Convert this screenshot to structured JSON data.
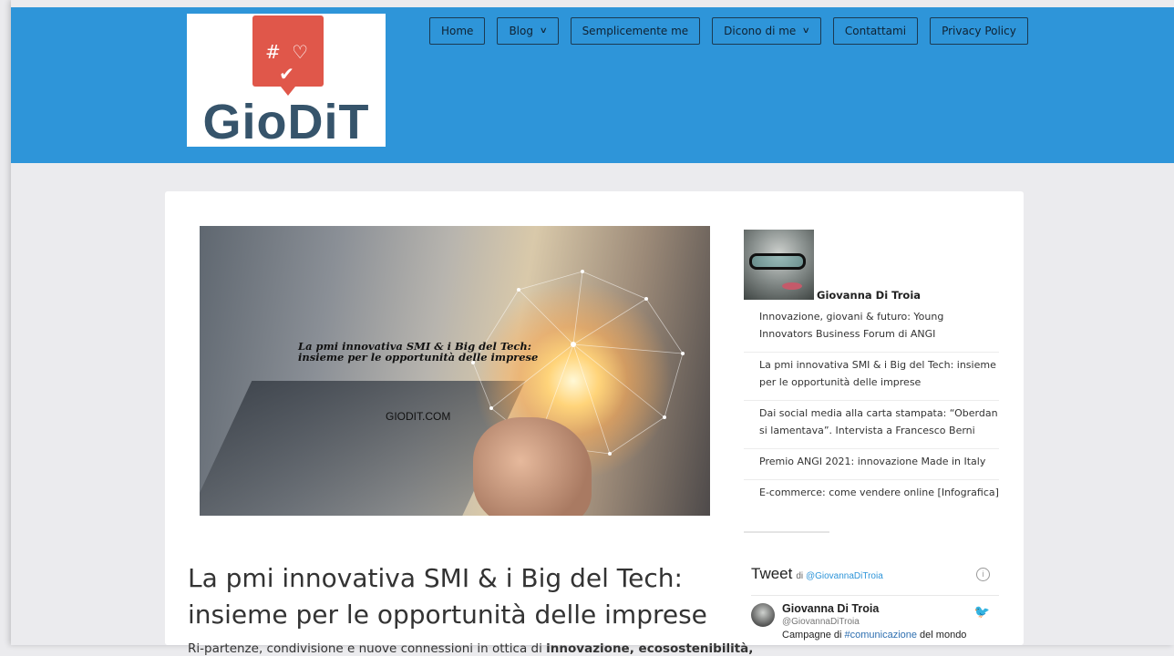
{
  "logo": {
    "symbols": "# ♡ ✔",
    "brand": "GioDiT"
  },
  "nav": [
    {
      "label": "Home",
      "dropdown": false
    },
    {
      "label": "Blog",
      "dropdown": true
    },
    {
      "label": "Semplicemente me",
      "dropdown": false
    },
    {
      "label": "Dicono di me",
      "dropdown": true
    },
    {
      "label": "Contattami",
      "dropdown": false
    },
    {
      "label": "Privacy Policy",
      "dropdown": false
    }
  ],
  "article": {
    "hero_caption_line1": "La pmi innovativa SMI & i Big del Tech:",
    "hero_caption_line2": "insieme per le opportunità delle imprese",
    "hero_site": "GIODIT.COM",
    "title": "La pmi innovativa SMI & i Big del Tech: insieme per le opportunità delle imprese",
    "excerpt_start": "Ri-partenze, condivisione e nuove connessioni in ottica di ",
    "excerpt_bold": "innovazione, ecosostenibilità,"
  },
  "sidebar": {
    "author": "Giovanna Di Troia",
    "recent_posts": [
      "Innovazione, giovani & futuro: Young Innovators Business Forum di ANGI",
      "La pmi innovativa SMI & i Big del Tech: insieme per le opportunità delle imprese",
      "Dai social media alla carta stampata: “Oberdan si lamentava”. Intervista a Francesco Berni",
      "Premio ANGI 2021: innovazione Made in Italy",
      "E-commerce: come vendere online [Infografica]"
    ],
    "twitter": {
      "title": "Tweet",
      "by_prefix": "di",
      "by_handle": "@GiovannaDiTroia",
      "name": "Giovanna Di Troia",
      "handle": "@GiovannaDiTroia",
      "text_start": "Campagne di ",
      "text_link": "#comunicazione",
      "text_end": " del mondo"
    }
  },
  "colors": {
    "header": "#2e95d9",
    "logo_red": "#e0574a",
    "logo_text": "#36546b"
  }
}
